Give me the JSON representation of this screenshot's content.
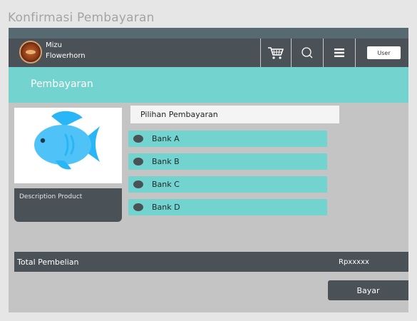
{
  "page": {
    "title": "Konfirmasi Pembayaran"
  },
  "header": {
    "brand_line1": "Mizu",
    "brand_line2": "Flowerhorn",
    "logo": "flowerhorn-logo",
    "icons": [
      "cart-icon",
      "search-icon",
      "menu-icon"
    ],
    "user_label": "User"
  },
  "banner": {
    "title": "Pembayaran"
  },
  "product": {
    "image_icon": "fish-icon",
    "description": "Description Product"
  },
  "payment": {
    "header": "Pilihan Pembayaran",
    "options": [
      {
        "label": "Bank A"
      },
      {
        "label": "Bank B"
      },
      {
        "label": "Bank C"
      },
      {
        "label": "Bank D"
      }
    ]
  },
  "total": {
    "label": "Total Pembelian",
    "value": "Rpxxxxx"
  },
  "actions": {
    "pay_label": "Bayar"
  },
  "colors": {
    "navbar": "#4a5157",
    "accent": "#72d3cf",
    "panel": "#c4c4c4",
    "fish": "#4fc3f7"
  }
}
